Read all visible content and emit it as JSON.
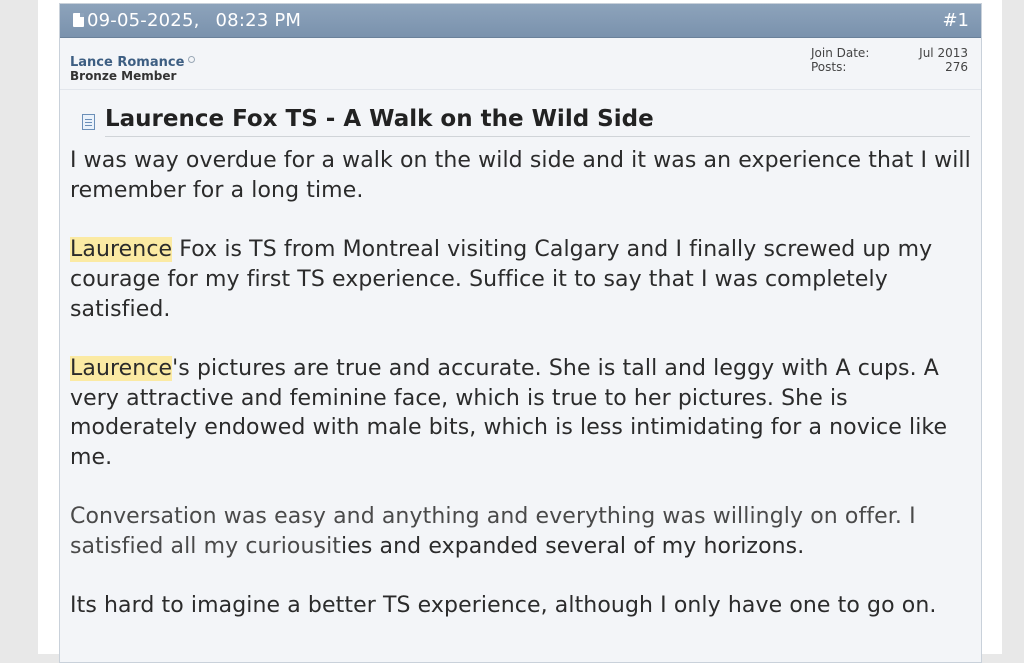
{
  "post": {
    "date": "09-05-2025,",
    "time": "08:23 PM",
    "number": "#1"
  },
  "user": {
    "name": "Lance Romance",
    "title": "Bronze Member",
    "join_label": "Join Date:",
    "join_value": "Jul 2013",
    "posts_label": "Posts:",
    "posts_value": "276"
  },
  "title": "Laurence Fox TS - A Walk on the Wild Side",
  "body": {
    "p1": "I was way overdue for a walk on the wild side and it was an experience that I will remember for a long time.",
    "p2_highlight": "Laurence",
    "p2_rest": " Fox is TS from Montreal visiting Calgary and I finally screwed up my courage for my first TS experience. Suffice it to say that I was completely satisfied.",
    "p3_highlight": "Laurence",
    "p3_rest": "'s pictures are true and accurate. She is tall and leggy with A cups. A very attractive and feminine face, which is true to her pictures. She is moderately endowed with male bits, which is less intimidating for a novice like me.",
    "p4_a": "Conversation was easy and anything and everything was willingly on offer. I satisfied all my curiousit",
    "p4_b": "ies and expanded several of my horizons.",
    "p5": "Its hard to imagine a better TS experience, although I only have one to go on."
  },
  "colors": {
    "header_bg": "#7a92ad",
    "username": "#3d5e82",
    "highlight": "#fbeaa3"
  }
}
